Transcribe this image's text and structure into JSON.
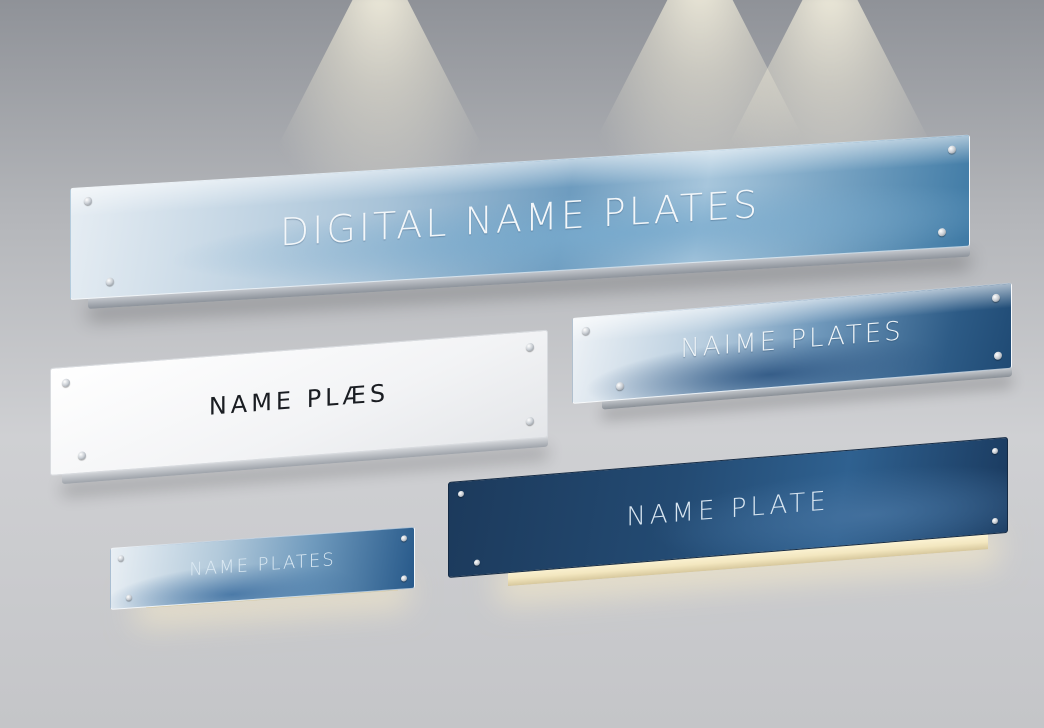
{
  "plates": {
    "digital": {
      "text": "DIGITAL  NAME PLATES"
    },
    "white": {
      "text": "NAME PLÆS"
    },
    "glass_right": {
      "text": "NAIME PLATES"
    },
    "small_lit": {
      "text": "NAME PLATES"
    },
    "dark_lit": {
      "text": "NAME PLATE"
    }
  },
  "colors": {
    "wall_top": "#8f9298",
    "wall_bottom": "#cfd0d3",
    "plate_blue": "#5f8fb3",
    "plate_dark": "#1c3d5e",
    "light_warm": "#fff8dc"
  }
}
